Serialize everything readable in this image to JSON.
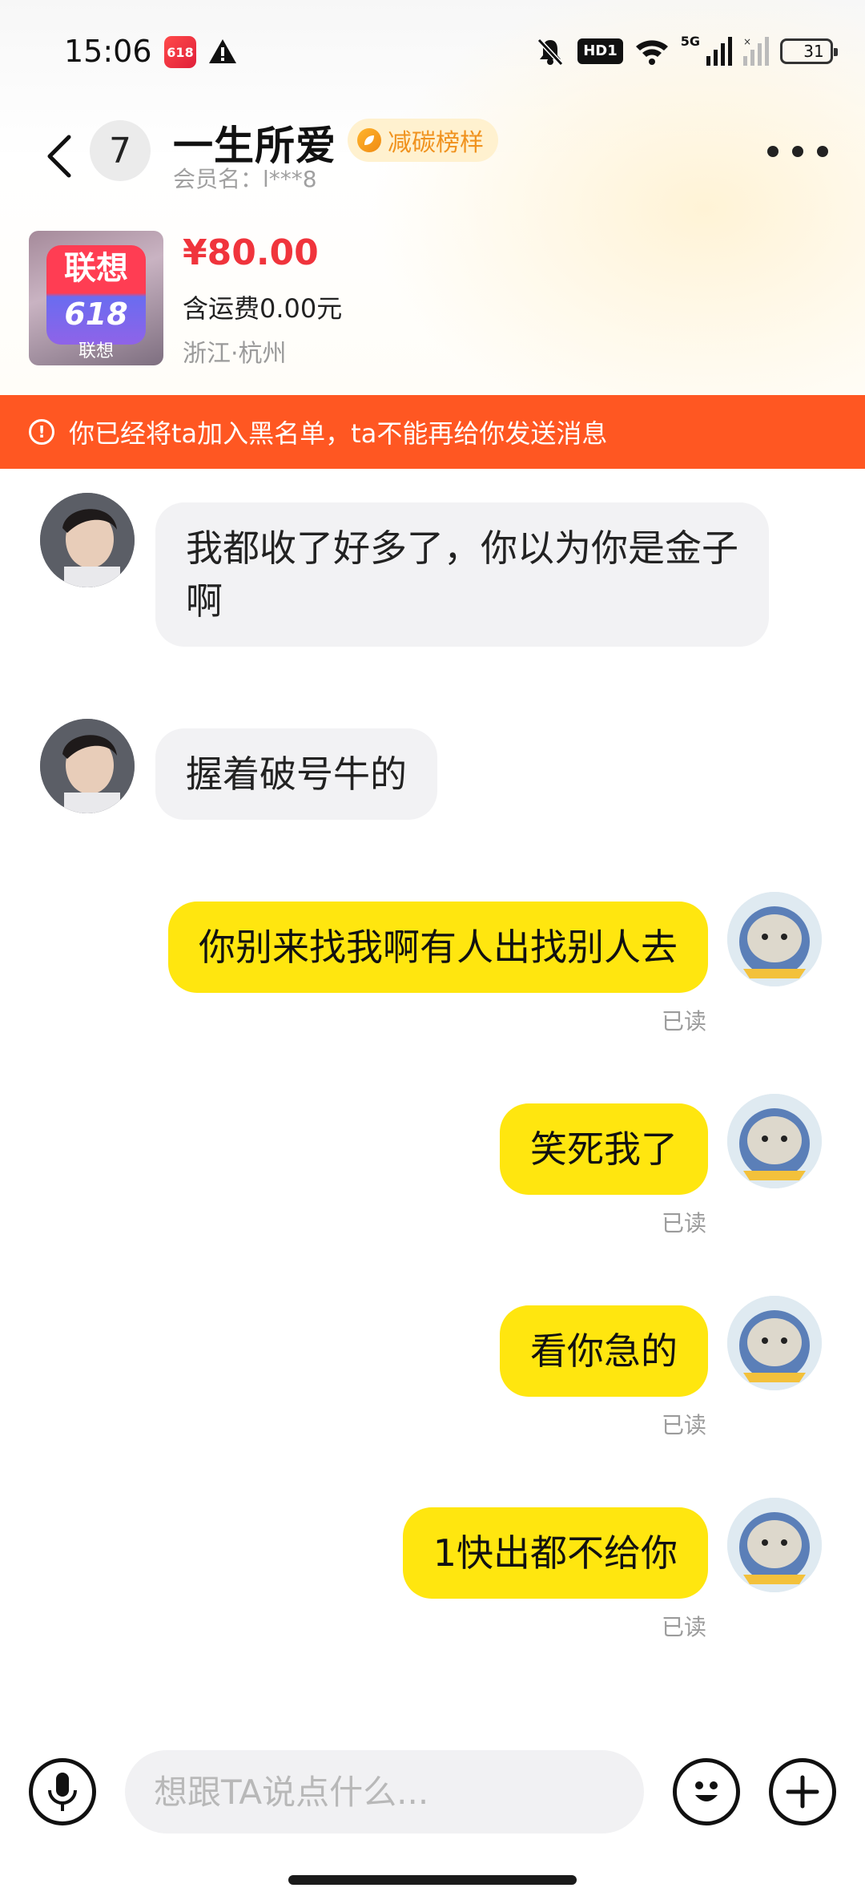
{
  "status_bar": {
    "time": "15:06",
    "app_icon_text": "618",
    "hd_label": "HD1",
    "network_label": "5G",
    "battery": "31"
  },
  "header": {
    "unread_count": "7",
    "contact_name": "一生所爱",
    "badge_label": "减碳榜样",
    "member_label": "会员名：l***8"
  },
  "product": {
    "thumb_title": "联想",
    "thumb_subtitle": "618",
    "thumb_caption": "联想",
    "price": "¥80.00",
    "shipping": "含运费0.00元",
    "location": "浙江·杭州"
  },
  "banner": {
    "text": "你已经将ta加入黑名单，ta不能再给你发送消息"
  },
  "messages": [
    {
      "side": "in",
      "text": "我都收了好多了，你以为你是金子啊"
    },
    {
      "side": "in",
      "text": "握着破号牛的"
    },
    {
      "side": "out",
      "text": "你别来找我啊有人出找别人去",
      "status": "已读"
    },
    {
      "side": "out",
      "text": "笑死我了",
      "status": "已读"
    },
    {
      "side": "out",
      "text": "看你急的",
      "status": "已读"
    },
    {
      "side": "out",
      "text": "1快出都不给你",
      "status": "已读"
    }
  ],
  "input": {
    "placeholder": "想跟TA说点什么..."
  },
  "colors": {
    "accent_orange": "#ff5722",
    "price_red": "#f0343c",
    "bubble_out": "#ffe60f",
    "bubble_in": "#f2f2f4"
  },
  "icons": [
    "back-arrow-icon",
    "more-dots-icon",
    "warning-circle-icon",
    "microphone-icon",
    "emoji-icon",
    "plus-icon"
  ]
}
